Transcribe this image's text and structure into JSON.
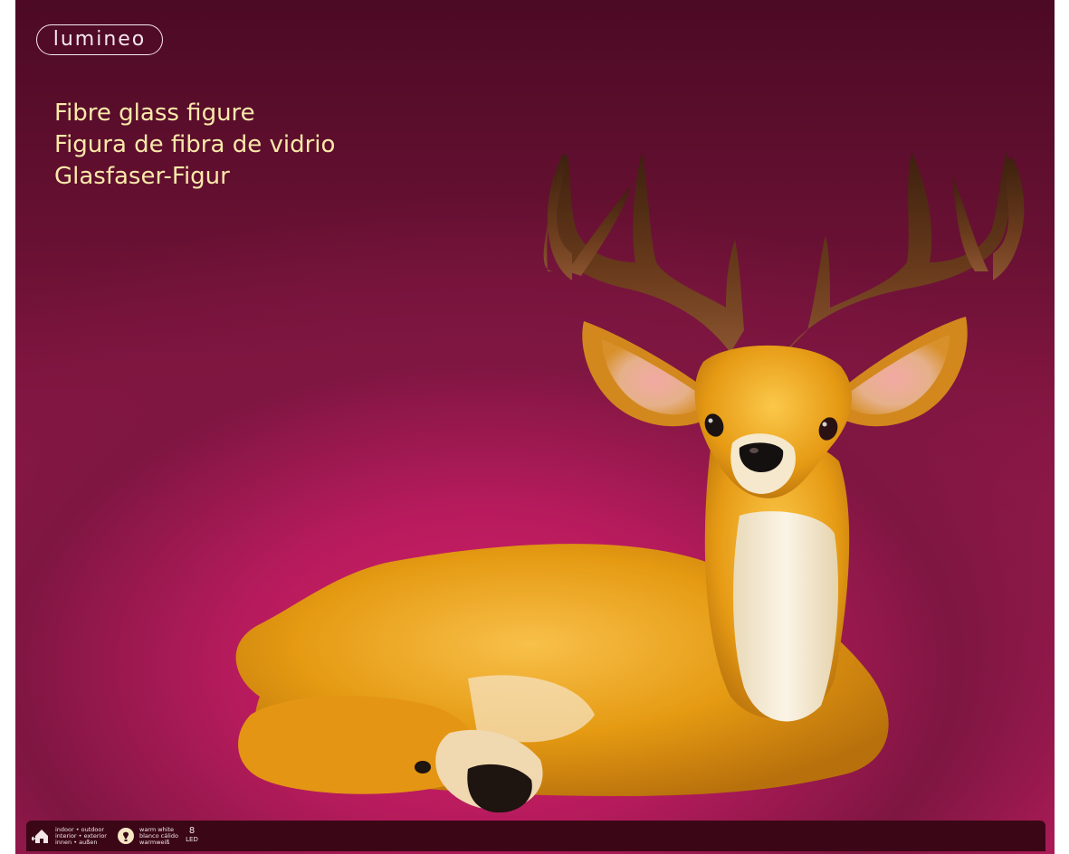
{
  "brand": {
    "logo_text": "lumineo"
  },
  "product": {
    "titles": [
      "Fibre glass figure",
      "Figura de fibra de vidrio",
      "Glasfaser-Figur"
    ]
  },
  "info_bar": {
    "location": {
      "icon": "indoor-outdoor-house-icon",
      "lines": [
        "indoor • outdoor",
        "interior • exterior",
        "innen • außen"
      ]
    },
    "light": {
      "icon": "warm-white-bulb-icon",
      "lines": [
        "warm white",
        "blanco cálido",
        "warmweiß"
      ]
    },
    "led": {
      "count": "8",
      "label": "LED"
    }
  },
  "colors": {
    "background_dark": "#4c0a24",
    "background_bright": "#d81e6a",
    "title_text": "#fbe9a9",
    "info_bar": "#3b0716",
    "deer_body": "#e59a12",
    "antler": "#6a3b1c"
  }
}
